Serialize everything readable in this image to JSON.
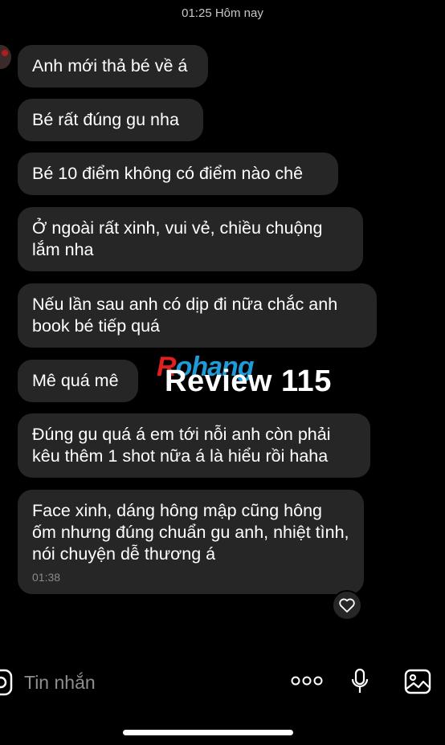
{
  "header": {
    "timestamp": "01:25 Hôm nay"
  },
  "messages": [
    {
      "text": "Anh mới thả bé về á"
    },
    {
      "text": "Bé rất đúng gu nha"
    },
    {
      "text": "Bé 10 điểm không có điểm nào chê"
    },
    {
      "text": "Ở ngoài rất xinh, vui vẻ, chiều chuộng lắm nha"
    },
    {
      "text": "Nếu lần sau anh có dịp đi nữa chắc anh book bé tiếp quá"
    },
    {
      "text": "Mê quá mê"
    },
    {
      "text": "Đúng gu quá á em tới nỗi anh còn phải kêu thêm 1 shot nữa á là hiểu rồi haha"
    },
    {
      "text": "Face xinh, dáng hông mập cũng hông ốm nhưng đúng chuẩn gu anh, nhiệt tình, nói chuyện dễ thương á",
      "time": "01:38"
    }
  ],
  "watermark": {
    "logo_r": "R",
    "logo_rest": "ohang",
    "text": "Review 115"
  },
  "composer": {
    "placeholder": "Tin nhắn"
  },
  "icons": {
    "avatar": "avatar",
    "heart": "heart-icon",
    "camera": "camera-icon",
    "more": "more-dots-icon",
    "mic": "microphone-icon",
    "gallery": "gallery-icon"
  },
  "colors": {
    "background": "#000000",
    "bubble": "#262626",
    "muted_text": "#8e8e8e"
  }
}
